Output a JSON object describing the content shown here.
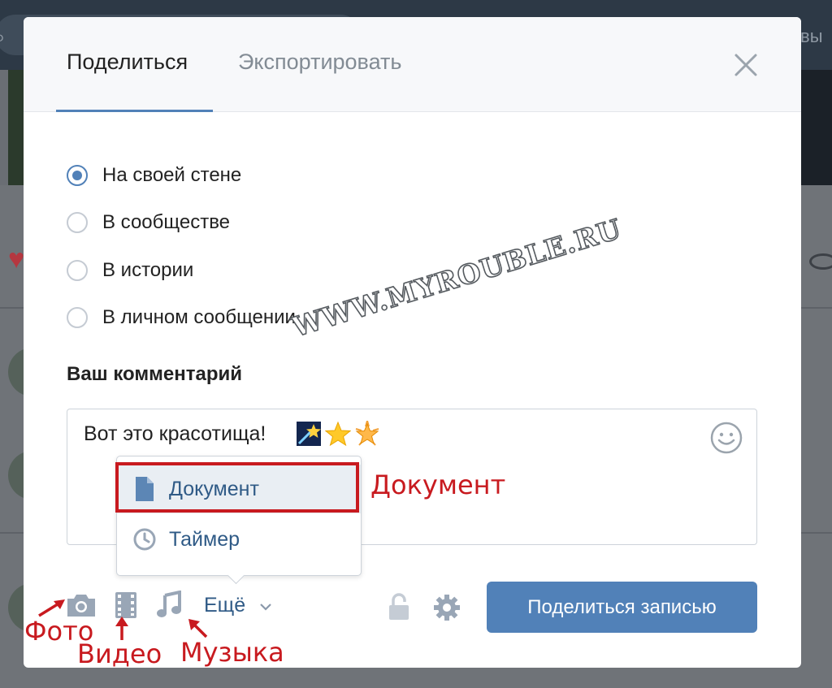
{
  "background": {
    "topbar_right_text": "вы"
  },
  "modal": {
    "tabs": [
      {
        "label": "Поделиться",
        "active": true
      },
      {
        "label": "Экспортировать",
        "active": false
      }
    ],
    "share_targets": [
      {
        "label": "На своей стене",
        "selected": true
      },
      {
        "label": "В сообществе",
        "selected": false
      },
      {
        "label": "В истории",
        "selected": false
      },
      {
        "label": "В личном сообщении",
        "selected": false
      }
    ],
    "comment": {
      "heading": "Ваш комментарий",
      "value": "Вот это красотища!",
      "emojis": [
        "shooting-star",
        "star",
        "glowing-star"
      ]
    },
    "attach_menu": {
      "items": [
        {
          "label": "Документ",
          "icon": "document-icon",
          "highlighted": true
        },
        {
          "label": "Таймер",
          "icon": "clock-icon",
          "highlighted": false
        }
      ]
    },
    "toolbar": {
      "more_label": "Ещё",
      "submit_label": "Поделиться записью"
    }
  },
  "annotations": {
    "document": "Документ",
    "photo": "Фото",
    "video": "Видео",
    "music": "Музыка"
  },
  "watermark": "WWW.MYROUBLE.RU",
  "colors": {
    "accent": "#5181b8",
    "link": "#2f5a86",
    "annotation": "#c81a1f"
  }
}
